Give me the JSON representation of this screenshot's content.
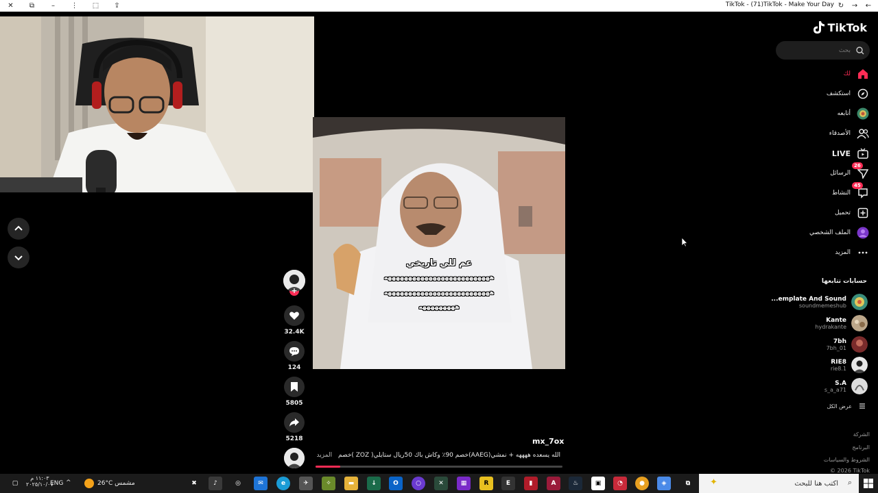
{
  "window": {
    "title": "TikTok - (71)TikTok - Make Your Day"
  },
  "video": {
    "caption_lines": [
      "عم للي تاريخي",
      "ههههههههههههههههههههههههههه",
      "ههههههههههههههههههههههههههه",
      "هههههههههه"
    ],
    "author": "mx_7ox",
    "description": "الله يسعده ههههه + نمشي(AAEG)خصم 90٪ وكاش باك 50ريال  ستايلي( ZOZ )خصم",
    "more_label": "المزيد",
    "progress": 0.1
  },
  "actions": {
    "likes": "32.4K",
    "comments": "124",
    "saves": "5805",
    "shares": "5218"
  },
  "sidebar": {
    "logo": "TikTok",
    "search_placeholder": "بحث",
    "nav": [
      {
        "label": "لك",
        "icon": "home-icon",
        "active": true
      },
      {
        "label": "استكشف",
        "icon": "compass-icon"
      },
      {
        "label": "أتابعه",
        "icon": "following-avatar-icon"
      },
      {
        "label": "الأصدقاء",
        "icon": "friends-icon"
      },
      {
        "label": "LIVE",
        "icon": "live-icon"
      },
      {
        "label": "الرسائل",
        "icon": "messages-icon",
        "badge": "26"
      },
      {
        "label": "النشاط",
        "icon": "activity-icon",
        "badge": "45"
      },
      {
        "label": "تحميل",
        "icon": "upload-icon"
      },
      {
        "label": "الملف الشخصي",
        "icon": "profile-avatar-icon"
      },
      {
        "label": "المزيد",
        "icon": "more-icon"
      }
    ],
    "following_title": "حسابات تتابعها",
    "following": [
      {
        "name": "...emplate And Sound",
        "user": "soundmemeshub"
      },
      {
        "name": "Kante",
        "user": "hydrakante"
      },
      {
        "name": "7bh",
        "user": "7bh_01"
      },
      {
        "name": "RIE8",
        "user": "rie8.1"
      },
      {
        "name": "S.A",
        "user": "s_a_a71"
      }
    ],
    "see_all": "عرض الكل",
    "footer": [
      "الشركة",
      "البرنامج",
      "الشروط والسياسات",
      "© 2026 TikTok"
    ]
  },
  "taskbar": {
    "search_placeholder": "اكتب هنا للبحث",
    "weather": "26°C  مشمس",
    "language": "ENG",
    "time": "١١:٠٣ م",
    "date": "٢٠٢٥/١٠/٠٧"
  },
  "colors": {
    "accent": "#fe2c55",
    "background": "#000000",
    "sidebar_text": "#eeeeee"
  }
}
